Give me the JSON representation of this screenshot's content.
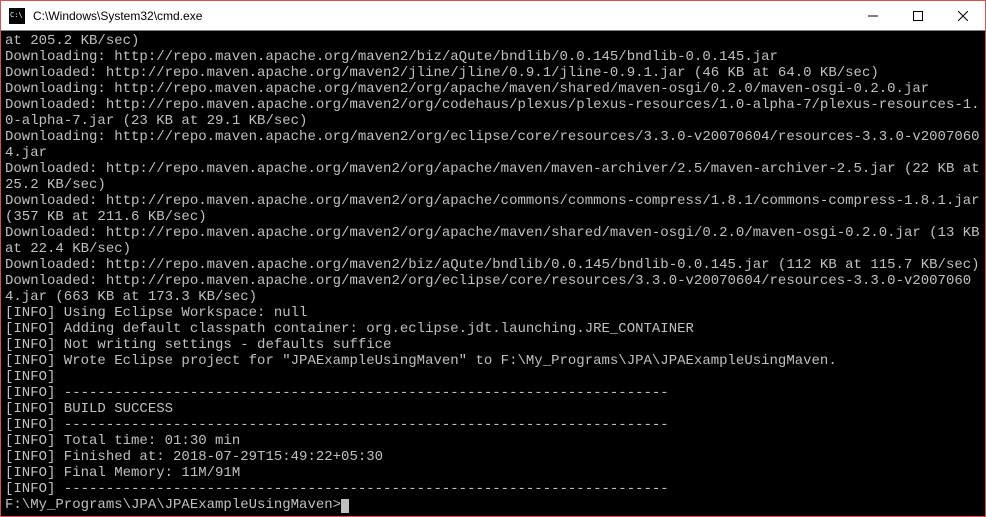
{
  "window": {
    "title": "C:\\Windows\\System32\\cmd.exe"
  },
  "lines": [
    "at 205.2 KB/sec)",
    "Downloading: http://repo.maven.apache.org/maven2/biz/aQute/bndlib/0.0.145/bndlib-0.0.145.jar",
    "Downloaded: http://repo.maven.apache.org/maven2/jline/jline/0.9.1/jline-0.9.1.jar (46 KB at 64.0 KB/sec)",
    "Downloading: http://repo.maven.apache.org/maven2/org/apache/maven/shared/maven-osgi/0.2.0/maven-osgi-0.2.0.jar",
    "Downloaded: http://repo.maven.apache.org/maven2/org/codehaus/plexus/plexus-resources/1.0-alpha-7/plexus-resources-1.0-alpha-7.jar (23 KB at 29.1 KB/sec)",
    "Downloading: http://repo.maven.apache.org/maven2/org/eclipse/core/resources/3.3.0-v20070604/resources-3.3.0-v20070604.jar",
    "Downloaded: http://repo.maven.apache.org/maven2/org/apache/maven/maven-archiver/2.5/maven-archiver-2.5.jar (22 KB at 25.2 KB/sec)",
    "Downloaded: http://repo.maven.apache.org/maven2/org/apache/commons/commons-compress/1.8.1/commons-compress-1.8.1.jar (357 KB at 211.6 KB/sec)",
    "Downloaded: http://repo.maven.apache.org/maven2/org/apache/maven/shared/maven-osgi/0.2.0/maven-osgi-0.2.0.jar (13 KB at 22.4 KB/sec)",
    "Downloaded: http://repo.maven.apache.org/maven2/biz/aQute/bndlib/0.0.145/bndlib-0.0.145.jar (112 KB at 115.7 KB/sec)",
    "Downloaded: http://repo.maven.apache.org/maven2/org/eclipse/core/resources/3.3.0-v20070604/resources-3.3.0-v20070604.jar (663 KB at 173.3 KB/sec)",
    "[INFO] Using Eclipse Workspace: null",
    "[INFO] Adding default classpath container: org.eclipse.jdt.launching.JRE_CONTAINER",
    "[INFO] Not writing settings - defaults suffice",
    "[INFO] Wrote Eclipse project for \"JPAExampleUsingMaven\" to F:\\My_Programs\\JPA\\JPAExampleUsingMaven.",
    "[INFO]",
    "[INFO] ------------------------------------------------------------------------",
    "[INFO] BUILD SUCCESS",
    "[INFO] ------------------------------------------------------------------------",
    "[INFO] Total time: 01:30 min",
    "[INFO] Finished at: 2018-07-29T15:49:22+05:30",
    "[INFO] Final Memory: 11M/91M",
    "[INFO] ------------------------------------------------------------------------"
  ],
  "prompt": "F:\\My_Programs\\JPA\\JPAExampleUsingMaven>"
}
